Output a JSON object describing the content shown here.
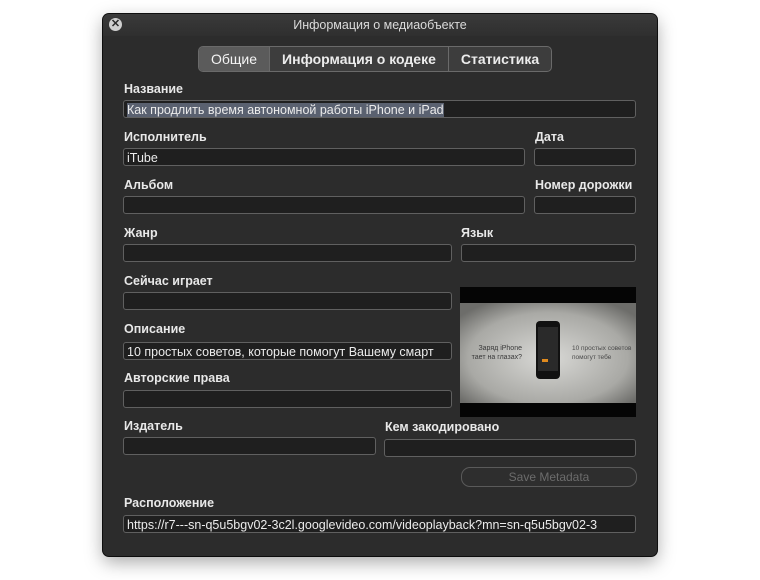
{
  "window": {
    "title": "Информация о медиаобъекте"
  },
  "tabs": [
    {
      "label": "Общие",
      "active": true
    },
    {
      "label": "Информация о кодеке",
      "active": false
    },
    {
      "label": "Статистика",
      "active": false
    }
  ],
  "fields": {
    "title": {
      "label": "Название",
      "value": "Как продлить время автономной работы iPhone и iPad"
    },
    "artist": {
      "label": "Исполнитель",
      "value": "iTube"
    },
    "date": {
      "label": "Дата",
      "value": ""
    },
    "album": {
      "label": "Альбом",
      "value": ""
    },
    "track_number": {
      "label": "Номер дорожки",
      "value": ""
    },
    "genre": {
      "label": "Жанр",
      "value": ""
    },
    "language": {
      "label": "Язык",
      "value": ""
    },
    "now_playing": {
      "label": "Сейчас играет",
      "value": ""
    },
    "description": {
      "label": "Описание",
      "value": "10 простых советов, которые помогут Вашему смарт"
    },
    "copyright": {
      "label": "Авторские права",
      "value": ""
    },
    "publisher": {
      "label": "Издатель",
      "value": ""
    },
    "encoded_by": {
      "label": "Кем закодировано",
      "value": ""
    },
    "location": {
      "label": "Расположение",
      "value": "https://r7---sn-q5u5bgv02-3c2l.googlevideo.com/videoplayback?mn=sn-q5u5bgv02-3"
    }
  },
  "buttons": {
    "save_metadata": "Save Metadata"
  },
  "artwork": {
    "left_text": [
      "Заряд iPhone",
      "тает на глазах?"
    ],
    "right_text": [
      "10 простых советов",
      "помогут тебе"
    ]
  },
  "colors": {
    "window_bg": "#2c2c2c",
    "field_bg": "#1f1f1f",
    "text": "#e8e8e8",
    "selection": "#5a6170"
  }
}
